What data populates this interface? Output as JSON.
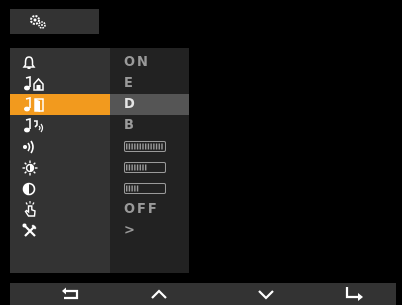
{
  "header": {
    "icon": "settings-gears-icon"
  },
  "menu": {
    "selected_index": 2,
    "rows": [
      {
        "id": "ringtone",
        "icon": "bell-icon",
        "value": "ON"
      },
      {
        "id": "call-ringtone",
        "icon": "music-house-icon",
        "value": "E"
      },
      {
        "id": "door-ringtone",
        "icon": "music-door-icon",
        "value": "D"
      },
      {
        "id": "intercom-ringtone",
        "icon": "music-intercom-icon",
        "value": "B"
      },
      {
        "id": "ring-volume",
        "icon": "volume-icon",
        "value": "",
        "level": 1.0
      },
      {
        "id": "brightness",
        "icon": "brightness-icon",
        "value": "",
        "level": 0.55
      },
      {
        "id": "contrast",
        "icon": "contrast-icon",
        "value": "",
        "level": 0.35
      },
      {
        "id": "key-sound",
        "icon": "touch-icon",
        "value": "OFF"
      },
      {
        "id": "settings",
        "icon": "tools-icon",
        "value": ">"
      }
    ]
  },
  "nav": [
    {
      "id": "back",
      "icon": "back-icon"
    },
    {
      "id": "up",
      "icon": "up-icon"
    },
    {
      "id": "down",
      "icon": "down-icon"
    },
    {
      "id": "enter",
      "icon": "enter-icon"
    }
  ],
  "colors": {
    "accent": "#f29a1e",
    "panel": "#333333",
    "value_bg": "#222222",
    "text": "#9a9a9a"
  }
}
